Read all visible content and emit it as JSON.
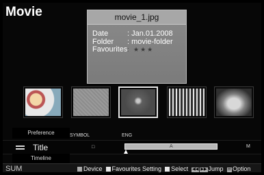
{
  "app": {
    "title": "Movie"
  },
  "info": {
    "filename": "movie_1.jpg",
    "rows": [
      {
        "key": "Date",
        "value": ": Jan.01.2008"
      },
      {
        "key": "Folder",
        "value": ": movie-folder"
      },
      {
        "key": "Favourites",
        "value": ": ★★★"
      }
    ]
  },
  "thumbnails": [
    {
      "name": "thumb-1",
      "selected": false
    },
    {
      "name": "thumb-2",
      "selected": false
    },
    {
      "name": "thumb-3",
      "selected": true
    },
    {
      "name": "thumb-4",
      "selected": false
    },
    {
      "name": "thumb-5",
      "selected": false
    }
  ],
  "sort": {
    "preference": "Preference",
    "symbol": "SYMBOL",
    "eng": "ENG",
    "title": "Title",
    "square": "□",
    "letter": "A",
    "letter_right": "M",
    "timeline": "Timeline"
  },
  "bottom_bar": {
    "sum": "SUM",
    "device": "Device",
    "favourites_setting": "Favourites Setting",
    "select": "Select",
    "jump": "Jump",
    "option": "Option"
  },
  "icons": {
    "menu": "menu-icon",
    "star": "star-icon",
    "pointer": "pointer-icon"
  }
}
